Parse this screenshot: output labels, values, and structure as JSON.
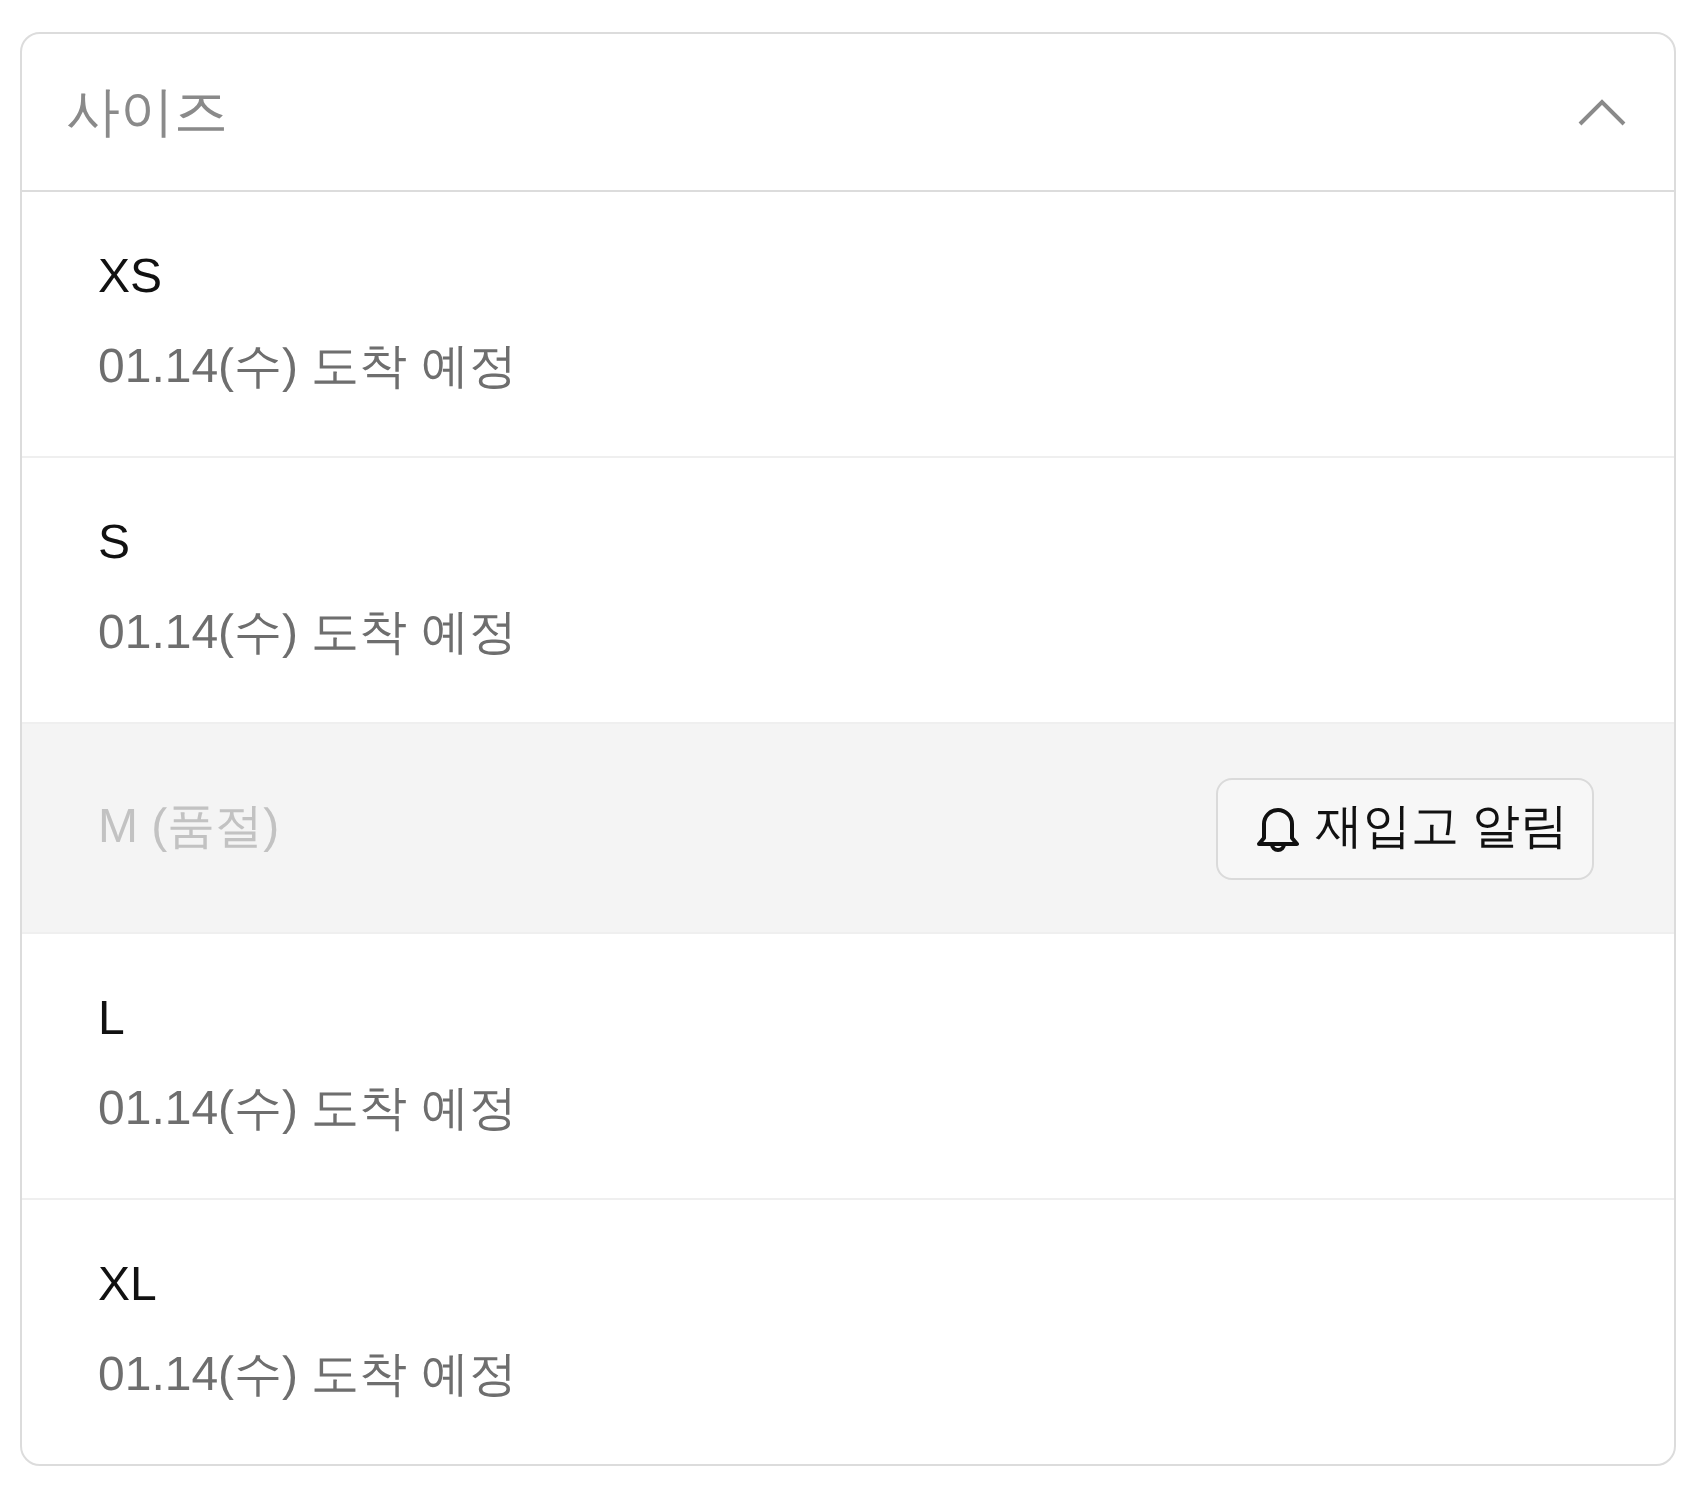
{
  "size_select": {
    "label": "사이즈",
    "expanded": true,
    "options": [
      {
        "size": "XS",
        "delivery": "01.14(수) 도착 예정",
        "sold_out": false
      },
      {
        "size": "S",
        "delivery": "01.14(수) 도착 예정",
        "sold_out": false
      },
      {
        "size": "M (품절)",
        "sold_out": true,
        "restock_button": "재입고 알림"
      },
      {
        "size": "L",
        "delivery": "01.14(수) 도착 예정",
        "sold_out": false
      },
      {
        "size": "XL",
        "delivery": "01.14(수) 도착 예정",
        "sold_out": false
      }
    ]
  }
}
